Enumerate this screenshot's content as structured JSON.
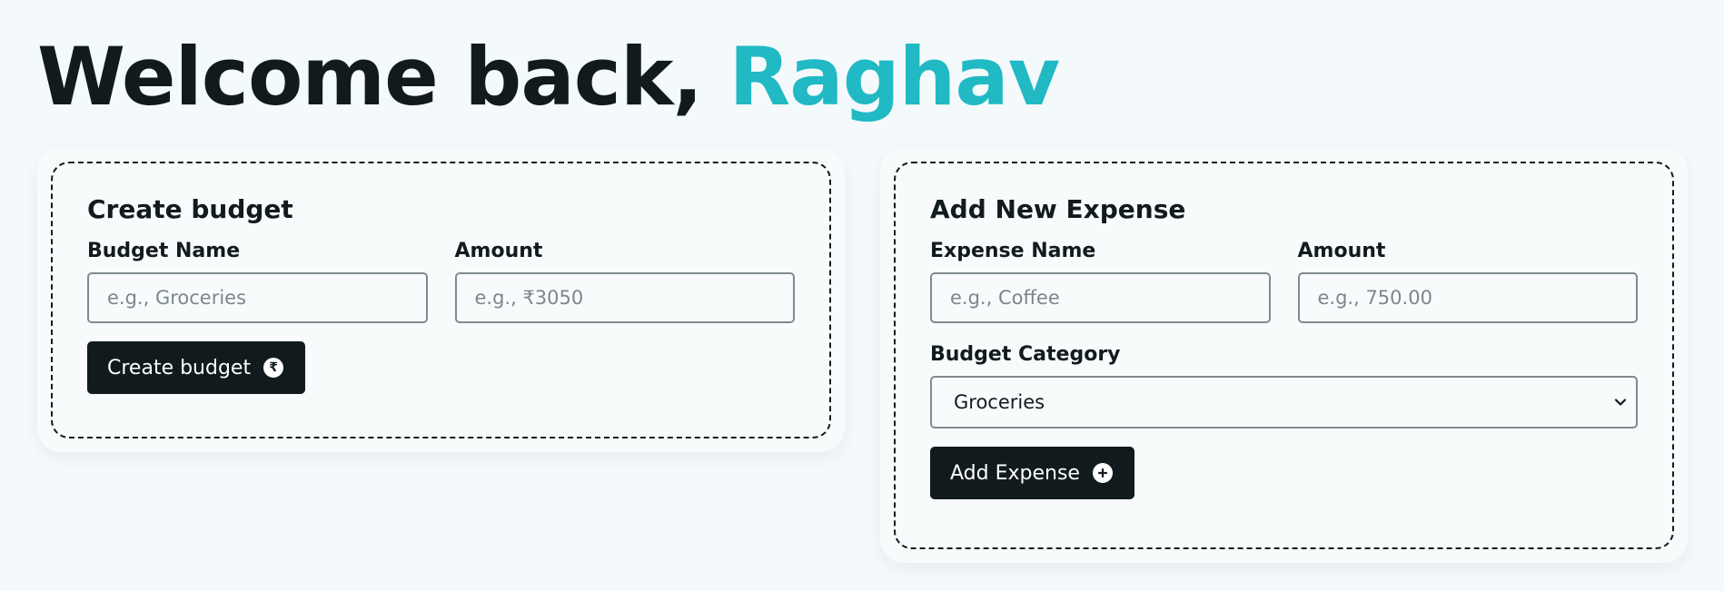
{
  "greeting": {
    "prefix": "Welcome back,",
    "name": "Raghav"
  },
  "create_budget": {
    "title": "Create budget",
    "name_label": "Budget Name",
    "name_placeholder": "e.g., Groceries",
    "amount_label": "Amount",
    "amount_placeholder": "e.g., ₹3050",
    "button_label": "Create budget",
    "button_icon": "rupee-circle-icon"
  },
  "add_expense": {
    "title": "Add New Expense",
    "name_label": "Expense Name",
    "name_placeholder": "e.g., Coffee",
    "amount_label": "Amount",
    "amount_placeholder": "e.g., 750.00",
    "category_label": "Budget Category",
    "category_selected": "Groceries",
    "button_label": "Add Expense",
    "button_icon": "plus-circle-icon"
  },
  "colors": {
    "background": "#f4fafb",
    "text": "#111b1d",
    "accent": "#20b9c4",
    "button": "#111b1d"
  }
}
